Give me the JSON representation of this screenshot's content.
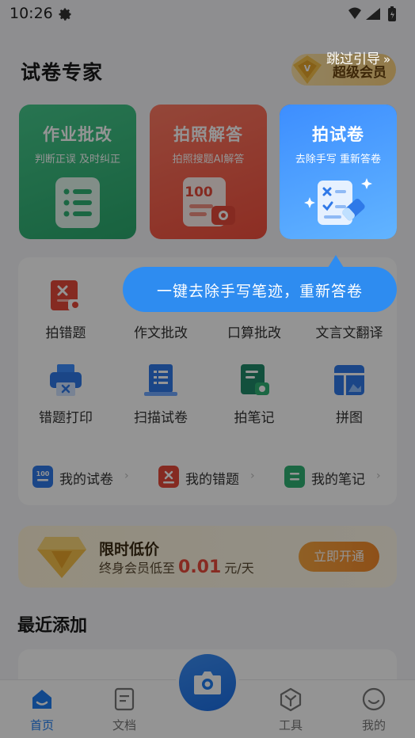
{
  "status_bar": {
    "time": "10:26"
  },
  "header": {
    "title": "试卷专家",
    "vip_label": "超级会员"
  },
  "guide": {
    "skip_label": "跳过引导",
    "skip_chevron": "»",
    "tooltip": "一键去除手写笔迹，重新答卷"
  },
  "feature_cards": [
    {
      "title": "作业批改",
      "subtitle": "判断正误 及时纠正"
    },
    {
      "title": "拍照解答",
      "subtitle": "拍照搜题AI解答",
      "badge": "100"
    },
    {
      "title": "拍试卷",
      "subtitle": "去除手写 重新答卷"
    }
  ],
  "tools": [
    {
      "label": "拍错题"
    },
    {
      "label": "作文批改"
    },
    {
      "label": "口算批改"
    },
    {
      "label": "文言文翻译"
    },
    {
      "label": "错题打印"
    },
    {
      "label": "扫描试卷"
    },
    {
      "label": "拍笔记"
    },
    {
      "label": "拼图"
    }
  ],
  "quick_links": [
    {
      "label": "我的试卷",
      "badge": "100"
    },
    {
      "label": "我的错题"
    },
    {
      "label": "我的笔记"
    }
  ],
  "promo": {
    "title": "限时低价",
    "prefix": "终身会员低至",
    "price": "0.01",
    "unit": "元/天",
    "cta": "立即开通"
  },
  "recent": {
    "title": "最近添加"
  },
  "bottom_nav": [
    {
      "label": "首页"
    },
    {
      "label": "文档"
    },
    {
      "label": "工具"
    },
    {
      "label": "我的"
    }
  ],
  "colors": {
    "accent": "#1e7cf2",
    "green": "#34b77a",
    "red": "#f4533f",
    "blue": "#3d8eff",
    "gold": "#f6a23a"
  }
}
